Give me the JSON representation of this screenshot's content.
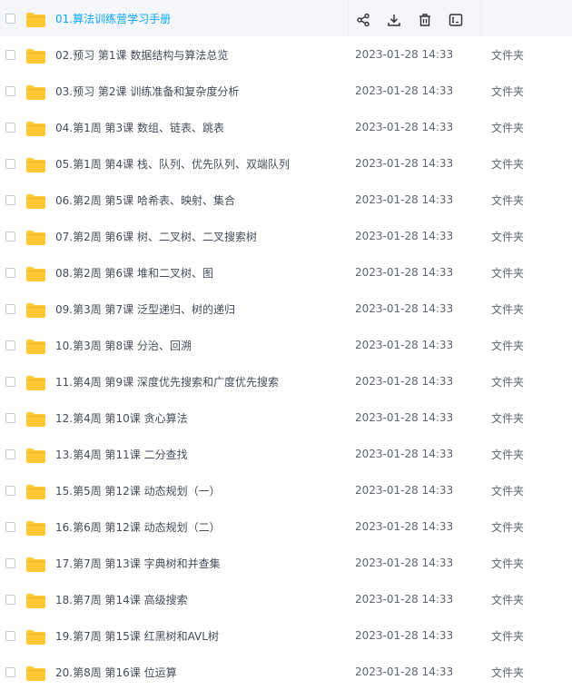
{
  "file_list": {
    "rows": [
      {
        "name": "01.算法训练营学习手册",
        "date": "",
        "type": ""
      },
      {
        "name": "02.预习 第1课  数据结构与算法总览",
        "date": "2023-01-28 14:33",
        "type": "文件夹"
      },
      {
        "name": "03.预习 第2课  训练准备和复杂度分析",
        "date": "2023-01-28 14:33",
        "type": "文件夹"
      },
      {
        "name": "04.第1周 第3课  数组、链表、跳表",
        "date": "2023-01-28 14:33",
        "type": "文件夹"
      },
      {
        "name": "05.第1周 第4课  栈、队列、优先队列、双端队列",
        "date": "2023-01-28 14:33",
        "type": "文件夹"
      },
      {
        "name": "06.第2周 第5课 哈希表、映射、集合",
        "date": "2023-01-28 14:33",
        "type": "文件夹"
      },
      {
        "name": "07.第2周 第6课 树、二叉树、二叉搜索树",
        "date": "2023-01-28 14:33",
        "type": "文件夹"
      },
      {
        "name": "08.第2周 第6课 堆和二叉树、图",
        "date": "2023-01-28 14:33",
        "type": "文件夹"
      },
      {
        "name": "09.第3周 第7课 泛型递归、树的递归",
        "date": "2023-01-28 14:33",
        "type": "文件夹"
      },
      {
        "name": "10.第3周 第8课 分治、回溯",
        "date": "2023-01-28 14:33",
        "type": "文件夹"
      },
      {
        "name": "11.第4周 第9课 深度优先搜索和广度优先搜索",
        "date": "2023-01-28 14:33",
        "type": "文件夹"
      },
      {
        "name": "12.第4周 第10课 贪心算法",
        "date": "2023-01-28 14:33",
        "type": "文件夹"
      },
      {
        "name": "13.第4周 第11课  二分查找",
        "date": "2023-01-28 14:33",
        "type": "文件夹"
      },
      {
        "name": "15.第5周 第12课 动态规划（一）",
        "date": "2023-01-28 14:33",
        "type": "文件夹"
      },
      {
        "name": "16.第6周 第12课 动态规划（二）",
        "date": "2023-01-28 14:33",
        "type": "文件夹"
      },
      {
        "name": "17.第7周 第13课 字典树和并查集",
        "date": "2023-01-28 14:33",
        "type": "文件夹"
      },
      {
        "name": "18.第7周 第14课 高级搜索",
        "date": "2023-01-28 14:33",
        "type": "文件夹"
      },
      {
        "name": "19.第7周 第15课 红黑树和AVL树",
        "date": "2023-01-28 14:33",
        "type": "文件夹"
      },
      {
        "name": "20.第8周 第16课  位运算",
        "date": "2023-01-28 14:33",
        "type": "文件夹"
      }
    ],
    "hover_actions": [
      "share-icon",
      "download-icon",
      "delete-icon",
      "rename-icon"
    ]
  },
  "colors": {
    "folder": "#ffc933",
    "folder_tab": "#f7b31f",
    "accent": "#06a7ff",
    "hover_row": "#f5f6fa"
  }
}
